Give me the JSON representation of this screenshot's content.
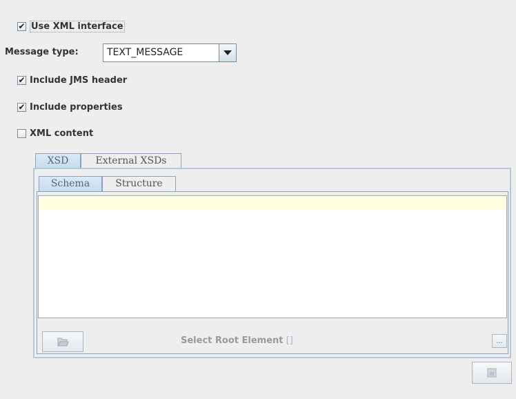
{
  "options": {
    "use_xml_interface": {
      "label": "Use XML interface",
      "checked": true
    },
    "message_type": {
      "label": "Message type:",
      "value": "TEXT_MESSAGE"
    },
    "include_jms_header": {
      "label": "Include JMS header",
      "checked": true
    },
    "include_properties": {
      "label": "Include properties",
      "checked": true
    },
    "xml_content": {
      "label": "XML content",
      "checked": false
    }
  },
  "outer_tabs": [
    {
      "label": "XSD",
      "selected": true
    },
    {
      "label": "External XSDs",
      "selected": false
    }
  ],
  "inner_tabs": [
    {
      "label": "Schema",
      "selected": true
    },
    {
      "label": "Structure",
      "selected": false
    }
  ],
  "schema_editor": {
    "text": ""
  },
  "footer": {
    "select_root_label": "Select Root Element",
    "select_root_value": "[]",
    "browse_button_label": "..."
  },
  "colors": {
    "background": "#eeeeee",
    "editor_highlight_line": "#ffffe0",
    "tab_selected": "#c5dcef",
    "border": "#8da2b8"
  },
  "icons": [
    "checkbox-check-icon",
    "dropdown-arrow-icon",
    "open-folder-icon",
    "document-icon"
  ]
}
